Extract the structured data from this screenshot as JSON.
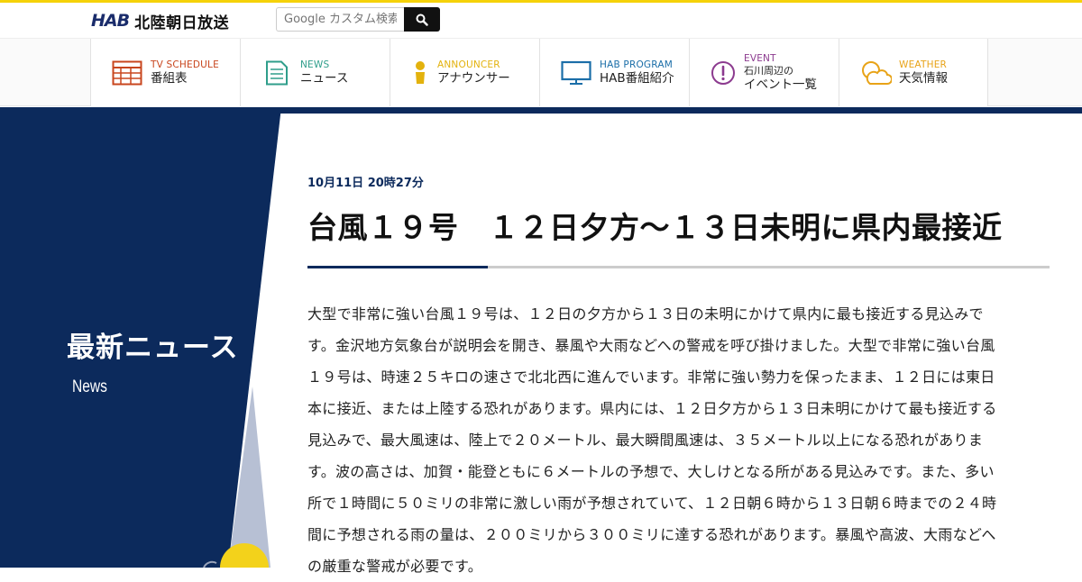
{
  "header": {
    "logo_mark": "HAB",
    "logo_text": "北陸朝日放送",
    "search_placeholder": "Google カスタム検索"
  },
  "nav": [
    {
      "en": "TV SCHEDULE",
      "ja": "番組表",
      "color": "#c8461e",
      "icon": "tv-schedule-icon"
    },
    {
      "en": "NEWS",
      "ja": "ニュース",
      "color": "#2f9e8b",
      "icon": "news-icon"
    },
    {
      "en": "ANNOUNCER",
      "ja": "アナウンサー",
      "color": "#e3b20d",
      "icon": "announcer-icon"
    },
    {
      "en": "HAB PROGRAM",
      "ja": "HAB番組紹介",
      "color": "#1b6ea8",
      "icon": "program-icon"
    },
    {
      "en": "EVENT",
      "ja_line1": "石川周辺の",
      "ja_line2": "イベント一覧",
      "color": "#8c3b8f",
      "icon": "event-icon"
    },
    {
      "en": "WEATHER",
      "ja": "天気情報",
      "color": "#e8a317",
      "icon": "weather-icon"
    }
  ],
  "section": {
    "title": "最新ニュース",
    "subtitle": "News"
  },
  "article": {
    "date": "10月11日 20時27分",
    "headline": "台風１９号　１２日夕方～１３日未明に県内最接近",
    "body": "大型で非常に強い台風１９号は、１２日の夕方から１３日の未明にかけて県内に最も接近する見込みです。金沢地方気象台が説明会を開き、暴風や大雨などへの警戒を呼び掛けました。大型で非常に強い台風１９号は、時速２５キロの速さで北北西に進んでいます。非常に強い勢力を保ったまま、１２日には東日本に接近、または上陸する恐れがあります。県内には、１２日夕方から１３日未明にかけて最も接近する見込みで、最大風速は、陸上で２０メートル、最大瞬間風速は、３５メートル以上になる恐れがあります。波の高さは、加賀・能登ともに６メートルの予想で、大しけとなる所がある見込みです。また、多い所で１時間に５０ミリの非常に激しい雨が予想されていて、１２日朝６時から１３日朝６時までの２４時間に予想される雨の量は、２００ミリから３００ミリに達する恐れがあります。暴風や高波、大雨などへの厳重な警戒が必要です。"
  },
  "colors": {
    "accent_yellow": "#f5d20a",
    "navy": "#0c2a5c"
  }
}
